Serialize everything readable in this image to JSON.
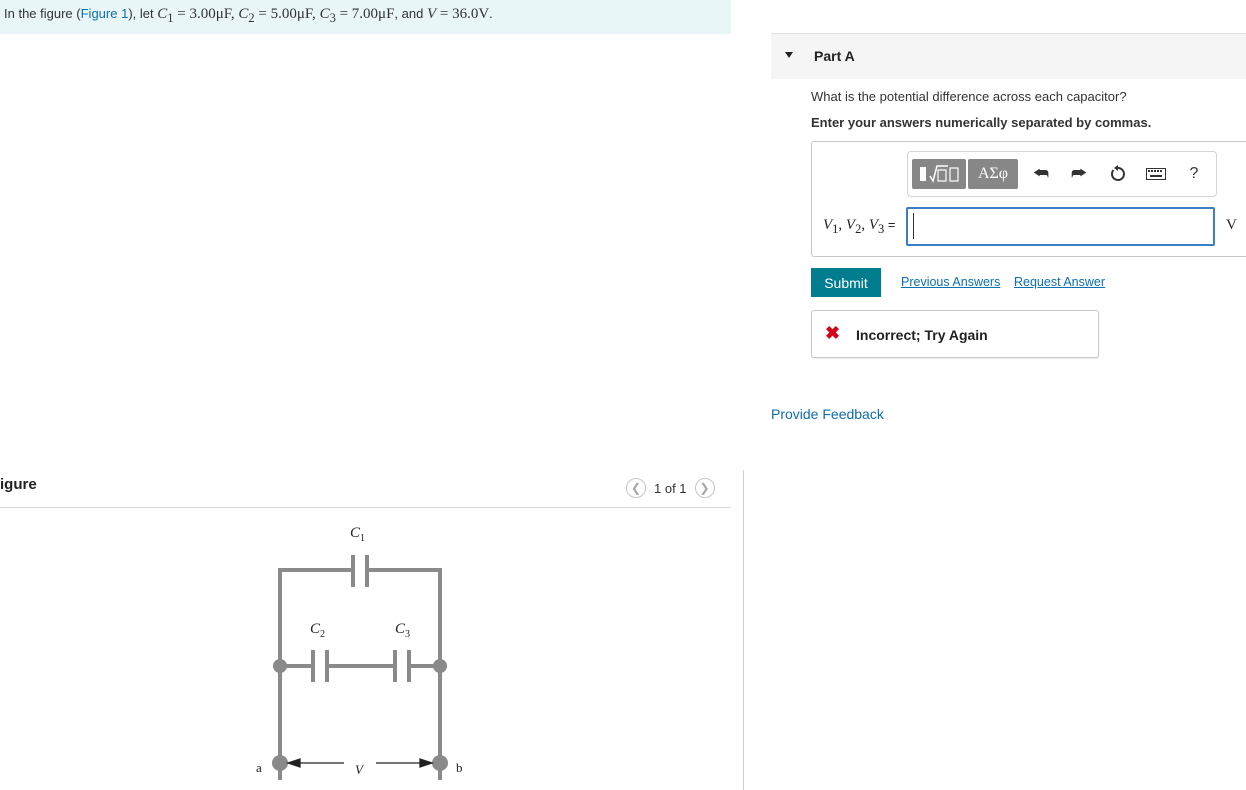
{
  "problem": {
    "prefix": "In the figure (",
    "figure_link": "Figure 1",
    "suffix": "), let ",
    "c1_sym": "C",
    "c1_sub": "1",
    "c1_val": " = 3.00μF, ",
    "c2_sym": "C",
    "c2_sub": "2",
    "c2_val": " = 5.00μF, ",
    "c3_sym": "C",
    "c3_sub": "3",
    "c3_val": " = 7.00μF",
    "and": ", and ",
    "v_sym": "V",
    "v_val": " = 36.0V",
    "end": "."
  },
  "figure": {
    "title": "igure",
    "pager": "1 of 1",
    "prev_icon": "chevron-left-icon",
    "next_icon": "chevron-right-icon",
    "labels": {
      "c1": "C",
      "c1_sub": "1",
      "c2": "C",
      "c2_sub": "2",
      "c3": "C",
      "c3_sub": "3",
      "a": "a",
      "b": "b",
      "v": "V"
    }
  },
  "part": {
    "title": "Part A",
    "question": "What is the potential difference across each capacitor?",
    "instruction": "Enter your answers numerically separated by commas.",
    "toolbar": {
      "templates_icon": "templates-icon",
      "greek_label": "ΑΣφ",
      "undo_icon": "undo-icon",
      "redo_icon": "redo-icon",
      "reset_icon": "reset-icon",
      "keyboard_icon": "keyboard-icon",
      "help_label": "?"
    },
    "input_label": {
      "v1": "V",
      "v1_sub": "1",
      "v2": "V",
      "v2_sub": "2",
      "v3": "V",
      "v3_sub": "3",
      "eq": " ="
    },
    "input_value": "",
    "unit": "V",
    "submit": "Submit",
    "previous_answers": "Previous Answers",
    "request_answer": "Request Answer",
    "feedback": "Incorrect; Try Again",
    "provide_feedback": "Provide Feedback"
  }
}
